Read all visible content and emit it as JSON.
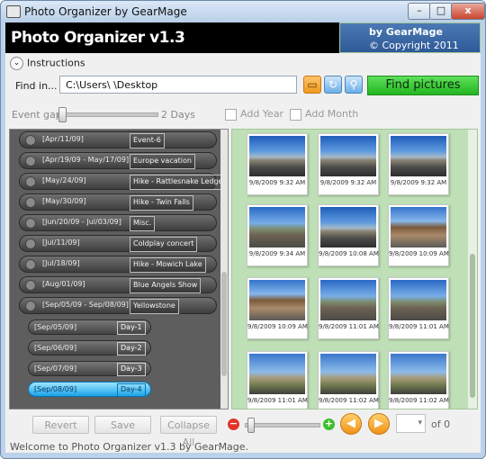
{
  "window": {
    "title": "Photo Organizer by GearMage",
    "controls": {
      "min": "–",
      "max": "□",
      "close": "x"
    }
  },
  "banner": {
    "logo": "Photo Organizer v1.3",
    "by": "by GearMage",
    "copyright": "© Copyright 2011"
  },
  "instructions": {
    "label": "Instructions",
    "icon": "chevron-down-icon"
  },
  "find": {
    "label": "Find in...",
    "path": "C:\\Users\\        \\Desktop",
    "button": "Find pictures"
  },
  "event_gap": {
    "label": "Event gap",
    "value": "2 Days"
  },
  "options": {
    "add_year": "Add Year",
    "add_month": "Add Month"
  },
  "events": [
    {
      "date": "[Apr/11/09]",
      "name": "Event-6"
    },
    {
      "date": "[Apr/19/09 - May/17/09]",
      "name": "Europe vacation"
    },
    {
      "date": "[May/24/09]",
      "name": "Hike - Rattlesnake Ledge"
    },
    {
      "date": "[May/30/09]",
      "name": "Hike - Twin Falls"
    },
    {
      "date": "[Jun/20/09 - Jul/03/09]",
      "name": "Misc."
    },
    {
      "date": "[Jul/11/09]",
      "name": "Coldplay concert"
    },
    {
      "date": "[Jul/18/09]",
      "name": "Hike  -  Mowich Lake"
    },
    {
      "date": "[Aug/01/09]",
      "name": "Blue Angels Show"
    },
    {
      "date": "[Sep/05/09 - Sep/08/09]",
      "name": "Yellowstone"
    }
  ],
  "days": [
    {
      "date": "[Sep/05/09]",
      "name": "Day-1"
    },
    {
      "date": "[Sep/06/09]",
      "name": "Day-2"
    },
    {
      "date": "[Sep/07/09]",
      "name": "Day-3"
    },
    {
      "date": "[Sep/08/09]",
      "name": "Day-4"
    }
  ],
  "photos": [
    {
      "caption": "9/8/2009 9:32 AM",
      "kind": "road"
    },
    {
      "caption": "9/8/2009 9:32 AM",
      "kind": "road"
    },
    {
      "caption": "9/8/2009 9:32 AM",
      "kind": "road"
    },
    {
      "caption": "9/8/2009 9:34 AM",
      "kind": "mtn"
    },
    {
      "caption": "9/8/2009 10:08 AM",
      "kind": "road"
    },
    {
      "caption": "9/8/2009 10:09 AM",
      "kind": "bldg"
    },
    {
      "caption": "9/8/2009 10:09 AM",
      "kind": "bldg"
    },
    {
      "caption": "9/8/2009 11:01 AM",
      "kind": "mtn"
    },
    {
      "caption": "9/8/2009 11:01 AM",
      "kind": "mtn"
    },
    {
      "caption": "9/8/2009 11:01 AM",
      "kind": "field"
    },
    {
      "caption": "9/8/2009 11:02 AM",
      "kind": "field"
    },
    {
      "caption": "9/8/2009 11:02 AM",
      "kind": "field"
    }
  ],
  "toolbar": {
    "revert": "Revert",
    "save": "Save",
    "collapse_all": "Collapse All",
    "zoom_out": "−",
    "zoom_in": "+",
    "prev": "◀",
    "next": "▶",
    "page_of": "of 0"
  },
  "status": "Welcome to Photo Organizer v1.3 by GearMage.",
  "colors": {
    "find_button": "#22b51f",
    "selected_day": "#1aa3e8",
    "thumb_panel": "#bfe0b6",
    "event_panel": "#5e5e5e"
  }
}
